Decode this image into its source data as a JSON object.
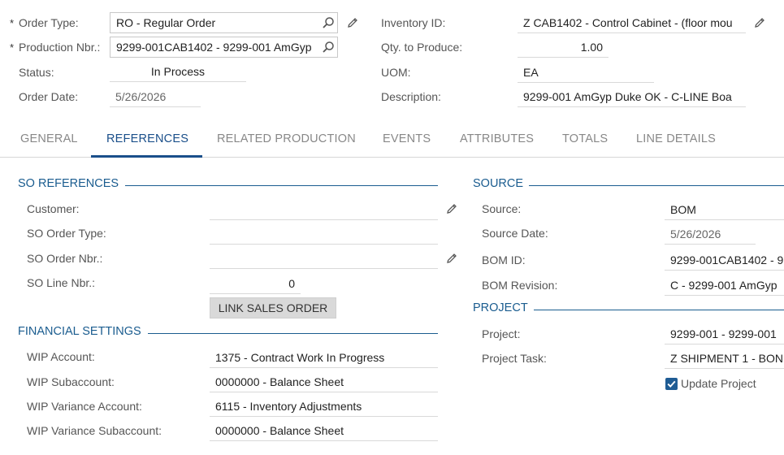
{
  "summary": {
    "order_type_label": "Order Type:",
    "order_type_value": "RO - Regular Order",
    "production_nbr_label": "Production Nbr.:",
    "production_nbr_value": "9299-001CAB1402 - 9299-001 AmGyp",
    "status_label": "Status:",
    "status_value": "In Process",
    "order_date_label": "Order Date:",
    "order_date_value": "5/26/2026",
    "inventory_id_label": "Inventory ID:",
    "inventory_id_value": "Z CAB1402 - Control Cabinet - (floor mou",
    "qty_label": "Qty. to Produce:",
    "qty_value": "1.00",
    "uom_label": "UOM:",
    "uom_value": "EA",
    "description_label": "Description:",
    "description_value": "9299-001 AmGyp Duke OK - C-LINE Boa"
  },
  "tabs": [
    {
      "label": "GENERAL"
    },
    {
      "label": "REFERENCES"
    },
    {
      "label": "RELATED PRODUCTION"
    },
    {
      "label": "EVENTS"
    },
    {
      "label": "ATTRIBUTES"
    },
    {
      "label": "TOTALS"
    },
    {
      "label": "LINE DETAILS"
    }
  ],
  "so_references": {
    "title": "SO REFERENCES",
    "customer_label": "Customer:",
    "customer_value": "",
    "so_order_type_label": "SO Order Type:",
    "so_order_type_value": "",
    "so_order_nbr_label": "SO Order Nbr.:",
    "so_order_nbr_value": "",
    "so_line_nbr_label": "SO Line Nbr.:",
    "so_line_nbr_value": "0",
    "link_button": "LINK SALES ORDER"
  },
  "financial": {
    "title": "FINANCIAL SETTINGS",
    "wip_account_label": "WIP Account:",
    "wip_account_value": "1375 - Contract Work In Progress",
    "wip_sub_label": "WIP Subaccount:",
    "wip_sub_value": "0000000 - Balance Sheet",
    "wip_var_label": "WIP Variance Account:",
    "wip_var_value": "6115 - Inventory Adjustments",
    "wip_var_sub_label": "WIP Variance Subaccount:",
    "wip_var_sub_value": "0000000 - Balance Sheet"
  },
  "source": {
    "title": "SOURCE",
    "source_label": "Source:",
    "source_value": "BOM",
    "source_date_label": "Source Date:",
    "source_date_value": "5/26/2026",
    "bom_id_label": "BOM ID:",
    "bom_id_value": "9299-001CAB1402 - 9",
    "bom_rev_label": "BOM Revision:",
    "bom_rev_value": "C - 9299-001 AmGyp"
  },
  "project": {
    "title": "PROJECT",
    "project_label": "Project:",
    "project_value": "9299-001 - 9299-001",
    "task_label": "Project Task:",
    "task_value": "Z SHIPMENT 1 - BON",
    "update_label": "Update Project"
  },
  "colors": {
    "accent": "#1a4f8a",
    "section": "#1a5c8f",
    "checkbox": "#1f5c94"
  }
}
